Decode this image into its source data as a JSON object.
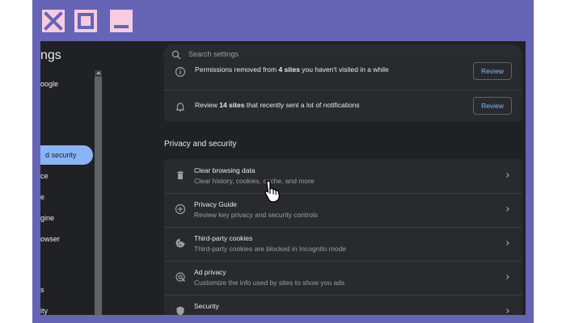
{
  "window_controls": {
    "close_icon": "close-icon",
    "maximize_icon": "maximize-icon",
    "minimize_icon": "minimize-icon"
  },
  "colors": {
    "frame": "#6664b5",
    "window_controls": "#f7cbe0",
    "background": "#202124",
    "card": "#292a2d",
    "accent": "#8ab4f8",
    "text": "#e8eaed",
    "subtext": "#9aa0a6"
  },
  "sidebar": {
    "title": "ngs",
    "items": [
      {
        "label": "oogle"
      },
      {
        "label": "d security",
        "active": true
      },
      {
        "label": "ce"
      },
      {
        "label": "e"
      },
      {
        "label": "gine"
      },
      {
        "label": "owser"
      },
      {
        "label": ""
      },
      {
        "label": "s"
      },
      {
        "label": "ity"
      }
    ]
  },
  "search": {
    "icon": "search-icon",
    "placeholder": "Search settings"
  },
  "safety_notices": [
    {
      "icon": "info-icon",
      "text_before": "Permissions removed from ",
      "text_bold": "4 sites",
      "text_after": " you haven't visited in a while",
      "button_label": "Review"
    },
    {
      "icon": "bell-icon",
      "text_before": "Review ",
      "text_bold": "14 sites",
      "text_after": " that recently sent a lot of notifications",
      "button_label": "Review"
    }
  ],
  "privacy_section": {
    "title": "Privacy and security",
    "items": [
      {
        "icon": "trash-icon",
        "title": "Clear browsing data",
        "subtitle": "Clear history, cookies, cache, and more"
      },
      {
        "icon": "privacy-guide-icon",
        "title": "Privacy Guide",
        "subtitle": "Review key privacy and security controls"
      },
      {
        "icon": "cookie-icon",
        "title": "Third-party cookies",
        "subtitle": "Third-party cookies are blocked in Incognito mode"
      },
      {
        "icon": "ad-privacy-icon",
        "title": "Ad privacy",
        "subtitle": "Customize the info used by sites to show you ads"
      },
      {
        "icon": "shield-icon",
        "title": "Security",
        "subtitle": ""
      }
    ]
  },
  "cursor": "hand-pointer-icon"
}
